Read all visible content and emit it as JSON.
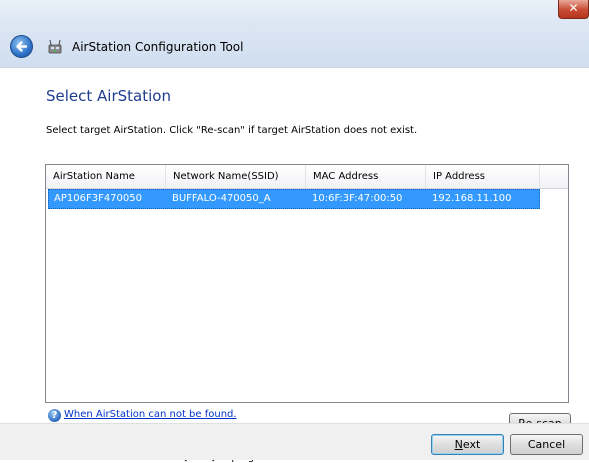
{
  "window": {
    "title": "AirStation Configuration Tool",
    "close_symbol": "✕",
    "back_icon": "back-arrow-icon",
    "app_icon": "airstation-app-icon"
  },
  "page": {
    "heading": "Select AirStation",
    "instruction": "Select target AirStation. Click \"Re-scan\" if target AirStation does not exist.",
    "progress_text": "Select AirStation then click [Next] to progress."
  },
  "table": {
    "columns": [
      "AirStation Name",
      "Network Name(SSID)",
      "MAC Address",
      "IP Address"
    ],
    "rows": [
      {
        "name": "AP106F3F470050",
        "ssid": "BUFFALO-470050_A",
        "mac": "10:6F:3F:47:00:50",
        "ip": "192.168.11.100",
        "selected": true
      }
    ]
  },
  "help": {
    "icon": "help-question-icon",
    "symbol": "?",
    "link_text": "When AirStation can not be found."
  },
  "buttons": {
    "rescan_accel": "R",
    "rescan_rest": "e-scan",
    "next_accel": "N",
    "next_rest": "ext",
    "cancel": "Cancel"
  },
  "colors": {
    "heading": "#1e3d8f",
    "selection": "#3399ff",
    "link": "#0033cc",
    "close_button": "#c74a32"
  }
}
